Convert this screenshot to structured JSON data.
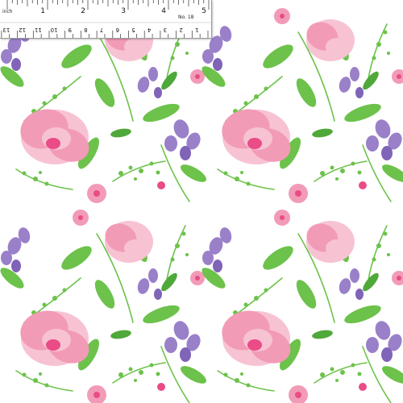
{
  "image": {
    "description_type": "floral fabric swatch",
    "colors": {
      "background": "#ffffff",
      "peony_pink": "#f29bb7",
      "peony_light": "#f7c3d3",
      "peony_hot": "#e94c86",
      "lavender": "#9a80c9",
      "lavender_dark": "#7f64b8",
      "leaf_green": "#6cc24a",
      "leaf_dark": "#4fa83a"
    }
  },
  "ruler": {
    "unit_label": "inch",
    "model_label": "No. 18",
    "inch_numbers": [
      "1",
      "2",
      "3",
      "4",
      "5"
    ],
    "cm_numbers": [
      "1",
      "2",
      "3",
      "4",
      "5",
      "6",
      "7",
      "8",
      "9",
      "10",
      "11",
      "12",
      "13",
      "14"
    ]
  }
}
